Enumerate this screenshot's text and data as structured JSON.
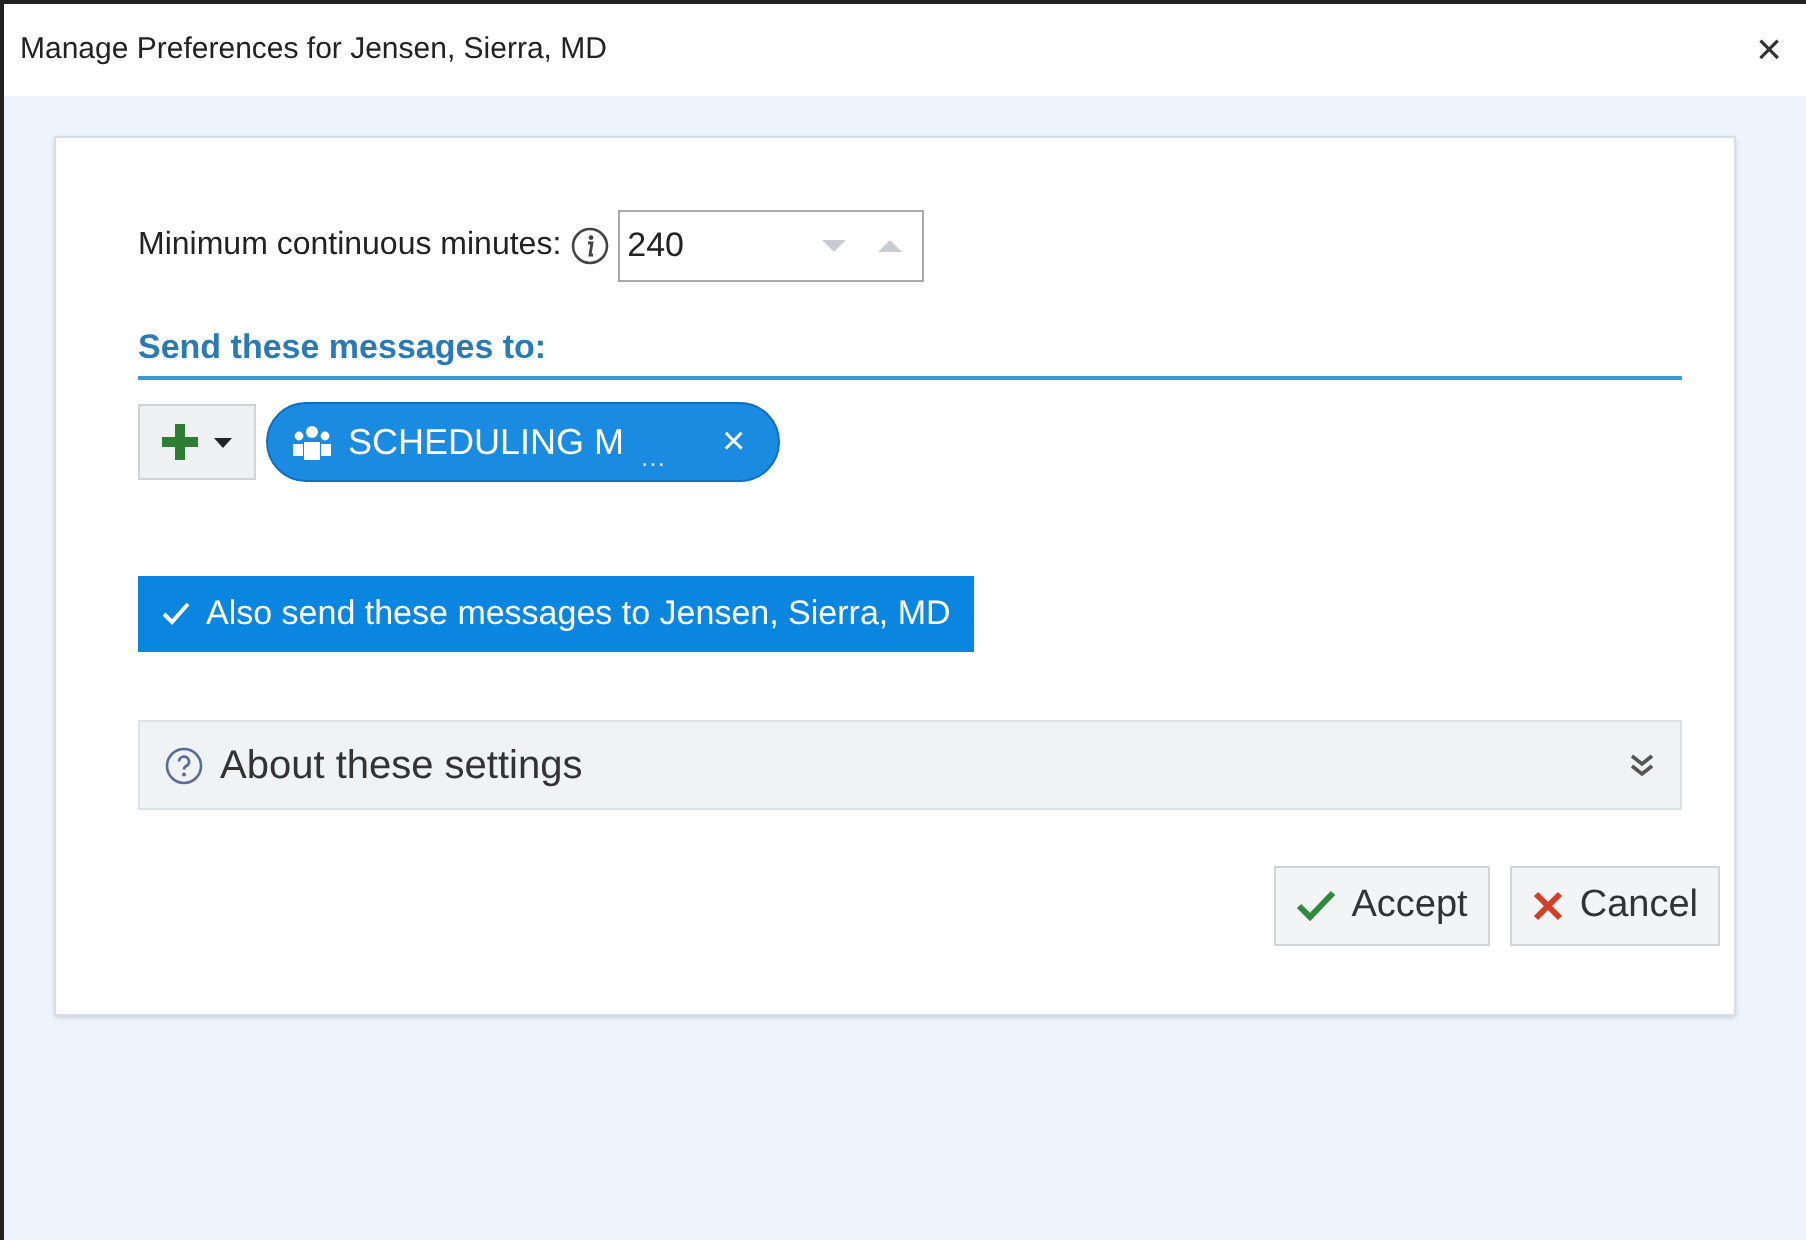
{
  "window": {
    "title": "Manage Preferences for Jensen, Sierra, MD",
    "close": "×"
  },
  "minutes": {
    "label": "Minimum continuous minutes:",
    "value": "240"
  },
  "recipients": {
    "heading": "Send these messages to:",
    "chips": [
      {
        "label": "SCHEDULING M",
        "overflow": "…",
        "remove": "×"
      }
    ]
  },
  "also_send": {
    "label": "Also send these messages to Jensen, Sierra, MD",
    "checked": true
  },
  "about": {
    "label": "About these settings",
    "expanded": false
  },
  "buttons": [
    {
      "label": "Accept",
      "kind": "accept"
    },
    {
      "label": "Cancel",
      "kind": "cancel"
    }
  ]
}
